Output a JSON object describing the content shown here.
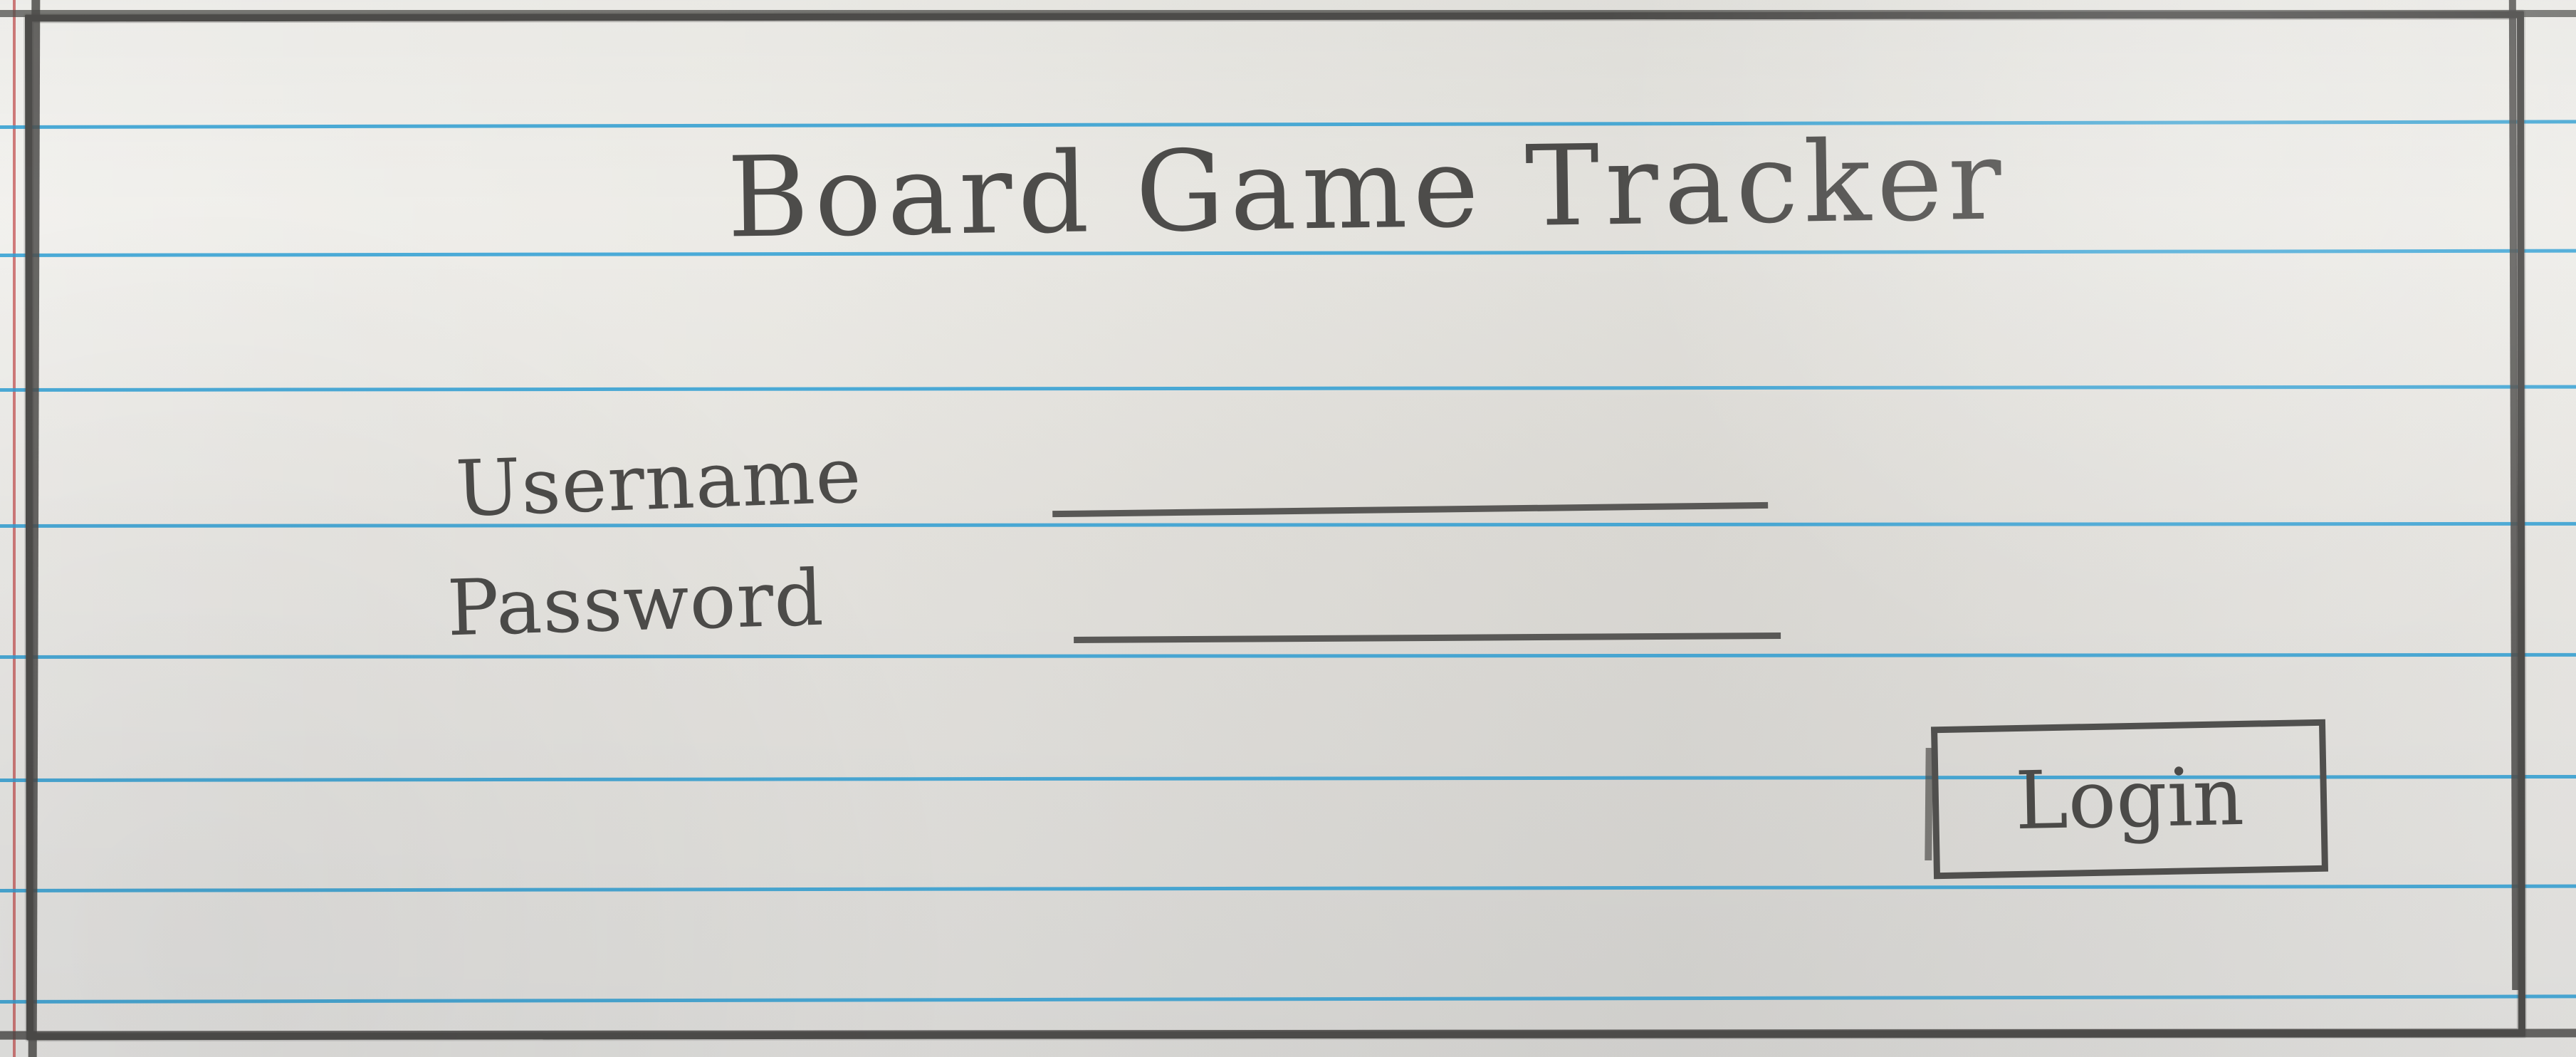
{
  "app": {
    "title": "Board Game Tracker"
  },
  "form": {
    "username_label": "Username",
    "password_label": "Password",
    "login_label": "Login"
  }
}
